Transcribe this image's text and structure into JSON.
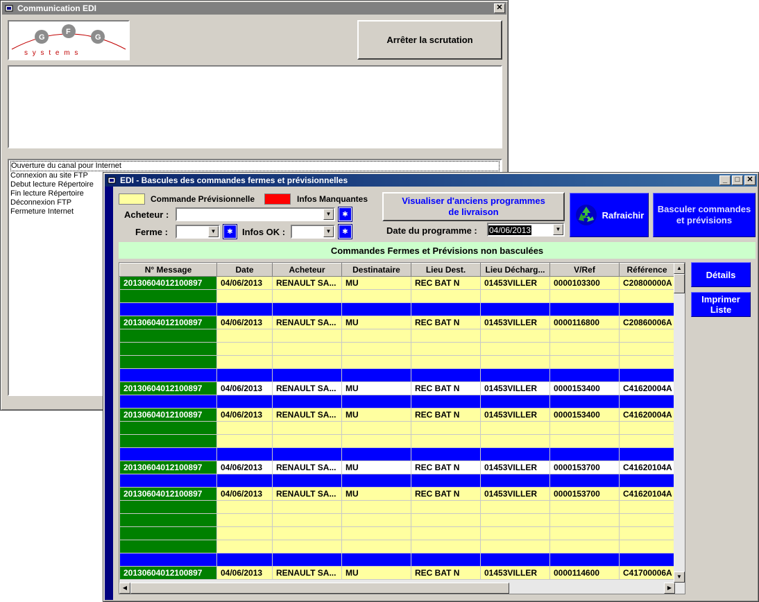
{
  "comm_window": {
    "title": "Communication EDI",
    "close_label": "✕",
    "logo_letters": [
      "G",
      "F",
      "G"
    ],
    "logo_subtext": "s y s t e m s",
    "stop_button": "Arrêter la scrutation",
    "log_lines": [
      "Ouverture du canal pour Internet",
      "Connexion au site FTP",
      "Debut lecture Répertoire",
      "Fin lecture Répertoire",
      "Déconnexion FTP",
      "Fermeture Internet"
    ]
  },
  "edi_window": {
    "title": "EDI - Bascules des commandes fermes et prévisionnelles",
    "min_label": "_",
    "max_label": "□",
    "close_label": "✕",
    "legend_prev": "Commande Prévisionnelle",
    "legend_missing": "Infos Manquantes",
    "acheteur_label": "Acheteur :",
    "acheteur_value": "",
    "ferme_label": "Ferme :",
    "ferme_value": "",
    "infos_ok_label": "Infos OK :",
    "infos_ok_value": "",
    "view_old_button": "Visualiser d'anciens programmes de livraison",
    "date_label": "Date du programme :",
    "date_value": "04/06/2013",
    "refresh_button": "Rafraichir",
    "basculer_button": "Basculer commandes et prévisions",
    "section_title": "Commandes Fermes et Prévisions non basculées",
    "details_button": "Détails",
    "print_button": "Imprimer Liste",
    "columns": [
      "N° Message",
      "Date",
      "Acheteur",
      "Destinataire",
      "Lieu Dest.",
      "Lieu Décharg...",
      "V/Ref",
      "Référence"
    ],
    "rows": [
      {
        "style": "y",
        "cells": [
          "20130604012100897",
          "04/06/2013",
          "RENAULT SA...",
          "MU",
          "REC BAT N",
          "01453VILLER",
          "0000103300",
          "C20800000A"
        ]
      },
      {
        "style": "y",
        "cells": [
          "",
          "",
          "",
          "",
          "",
          "",
          "",
          ""
        ]
      },
      {
        "style": "b",
        "cells": [
          "",
          "",
          "",
          "",
          "",
          "",
          "",
          ""
        ]
      },
      {
        "style": "y",
        "cells": [
          "20130604012100897",
          "04/06/2013",
          "RENAULT SA...",
          "MU",
          "REC BAT N",
          "01453VILLER",
          "0000116800",
          "C20860006A"
        ]
      },
      {
        "style": "y",
        "cells": [
          "",
          "",
          "",
          "",
          "",
          "",
          "",
          ""
        ]
      },
      {
        "style": "y",
        "cells": [
          "",
          "",
          "",
          "",
          "",
          "",
          "",
          ""
        ]
      },
      {
        "style": "y",
        "cells": [
          "",
          "",
          "",
          "",
          "",
          "",
          "",
          ""
        ]
      },
      {
        "style": "b",
        "cells": [
          "",
          "",
          "",
          "",
          "",
          "",
          "",
          ""
        ]
      },
      {
        "style": "w",
        "cells": [
          "20130604012100897",
          "04/06/2013",
          "RENAULT SA...",
          "MU",
          "REC BAT N",
          "01453VILLER",
          "0000153400",
          "C41620004A"
        ]
      },
      {
        "style": "b",
        "cells": [
          "",
          "",
          "",
          "",
          "",
          "",
          "",
          ""
        ]
      },
      {
        "style": "y",
        "cells": [
          "20130604012100897",
          "04/06/2013",
          "RENAULT SA...",
          "MU",
          "REC BAT N",
          "01453VILLER",
          "0000153400",
          "C41620004A"
        ]
      },
      {
        "style": "y",
        "cells": [
          "",
          "",
          "",
          "",
          "",
          "",
          "",
          ""
        ]
      },
      {
        "style": "y",
        "cells": [
          "",
          "",
          "",
          "",
          "",
          "",
          "",
          ""
        ]
      },
      {
        "style": "b",
        "cells": [
          "",
          "",
          "",
          "",
          "",
          "",
          "",
          ""
        ]
      },
      {
        "style": "w",
        "cells": [
          "20130604012100897",
          "04/06/2013",
          "RENAULT SA...",
          "MU",
          "REC BAT N",
          "01453VILLER",
          "0000153700",
          "C41620104A"
        ]
      },
      {
        "style": "b",
        "cells": [
          "",
          "",
          "",
          "",
          "",
          "",
          "",
          ""
        ]
      },
      {
        "style": "y",
        "cells": [
          "20130604012100897",
          "04/06/2013",
          "RENAULT SA...",
          "MU",
          "REC BAT N",
          "01453VILLER",
          "0000153700",
          "C41620104A"
        ]
      },
      {
        "style": "y",
        "cells": [
          "",
          "",
          "",
          "",
          "",
          "",
          "",
          ""
        ]
      },
      {
        "style": "y",
        "cells": [
          "",
          "",
          "",
          "",
          "",
          "",
          "",
          ""
        ]
      },
      {
        "style": "y",
        "cells": [
          "",
          "",
          "",
          "",
          "",
          "",
          "",
          ""
        ]
      },
      {
        "style": "y",
        "cells": [
          "",
          "",
          "",
          "",
          "",
          "",
          "",
          ""
        ]
      },
      {
        "style": "b",
        "cells": [
          "",
          "",
          "",
          "",
          "",
          "",
          "",
          ""
        ]
      },
      {
        "style": "y",
        "cells": [
          "20130604012100897",
          "04/06/2013",
          "RENAULT SA...",
          "MU",
          "REC BAT N",
          "01453VILLER",
          "0000114600",
          "C41700006A"
        ]
      }
    ],
    "colors": {
      "title_active": "#0a246a",
      "title_inactive": "#808080",
      "prev_yellow": "#ffffa0",
      "missing_red": "#ff0000",
      "msg_green": "#008000",
      "sep_blue": "#0000ff",
      "header_green": "#ccffcc"
    }
  }
}
